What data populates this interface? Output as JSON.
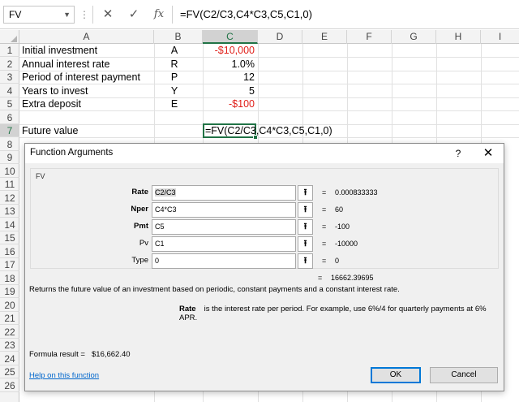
{
  "formula_bar": {
    "name_box": "FV",
    "formula": "=FV(C2/C3,C4*C3,C5,C1,0)"
  },
  "columns": [
    "A",
    "B",
    "C",
    "D",
    "E",
    "F",
    "G",
    "H",
    "I"
  ],
  "rows": [
    "1",
    "2",
    "3",
    "4",
    "5",
    "6",
    "7",
    "8",
    "9",
    "10",
    "11",
    "12",
    "13",
    "14",
    "15",
    "16",
    "17",
    "18",
    "19",
    "20",
    "21",
    "22",
    "23",
    "24",
    "25",
    "26"
  ],
  "sheet": {
    "r1": {
      "a": "Initial investment",
      "b": "A",
      "c": "-$10,000"
    },
    "r2": {
      "a": "Annual interest rate",
      "b": "R",
      "c": "1.0%"
    },
    "r3": {
      "a": "Period of interest payment",
      "b": "P",
      "c": "12"
    },
    "r4": {
      "a": "Years to invest",
      "b": "Y",
      "c": "5"
    },
    "r5": {
      "a": "Extra deposit",
      "b": "E",
      "c": "-$100"
    },
    "r7": {
      "a": "Future value",
      "c": "=FV(C2/C3,C4*C3,C5,C1,0)"
    }
  },
  "colors": {
    "accent": "#217346",
    "negative": "#e0201a",
    "link": "#0066cc"
  },
  "dialog": {
    "title": "Function Arguments",
    "help_btn": "?",
    "close_btn": "✕",
    "function_name": "FV",
    "args": [
      {
        "label": "Rate",
        "value": "C2/C3",
        "result": "0.000833333"
      },
      {
        "label": "Nper",
        "value": "C4*C3",
        "result": "60"
      },
      {
        "label": "Pmt",
        "value": "C5",
        "result": "-100"
      },
      {
        "label": "Pv",
        "value": "C1",
        "result": "-10000"
      },
      {
        "label": "Type",
        "value": "0",
        "result": "0"
      }
    ],
    "eq": "=",
    "result_value": "16662.39695",
    "description": "Returns the future value of an investment based on periodic, constant payments and a constant interest rate.",
    "arg_name": "Rate",
    "arg_description": "is the interest rate per period. For example, use 6%/4 for quarterly payments at 6% APR.",
    "formula_result_label": "Formula result =",
    "formula_result_value": "$16,662.40",
    "help_link": "Help on this function",
    "ok_label": "OK",
    "cancel_label": "Cancel"
  }
}
